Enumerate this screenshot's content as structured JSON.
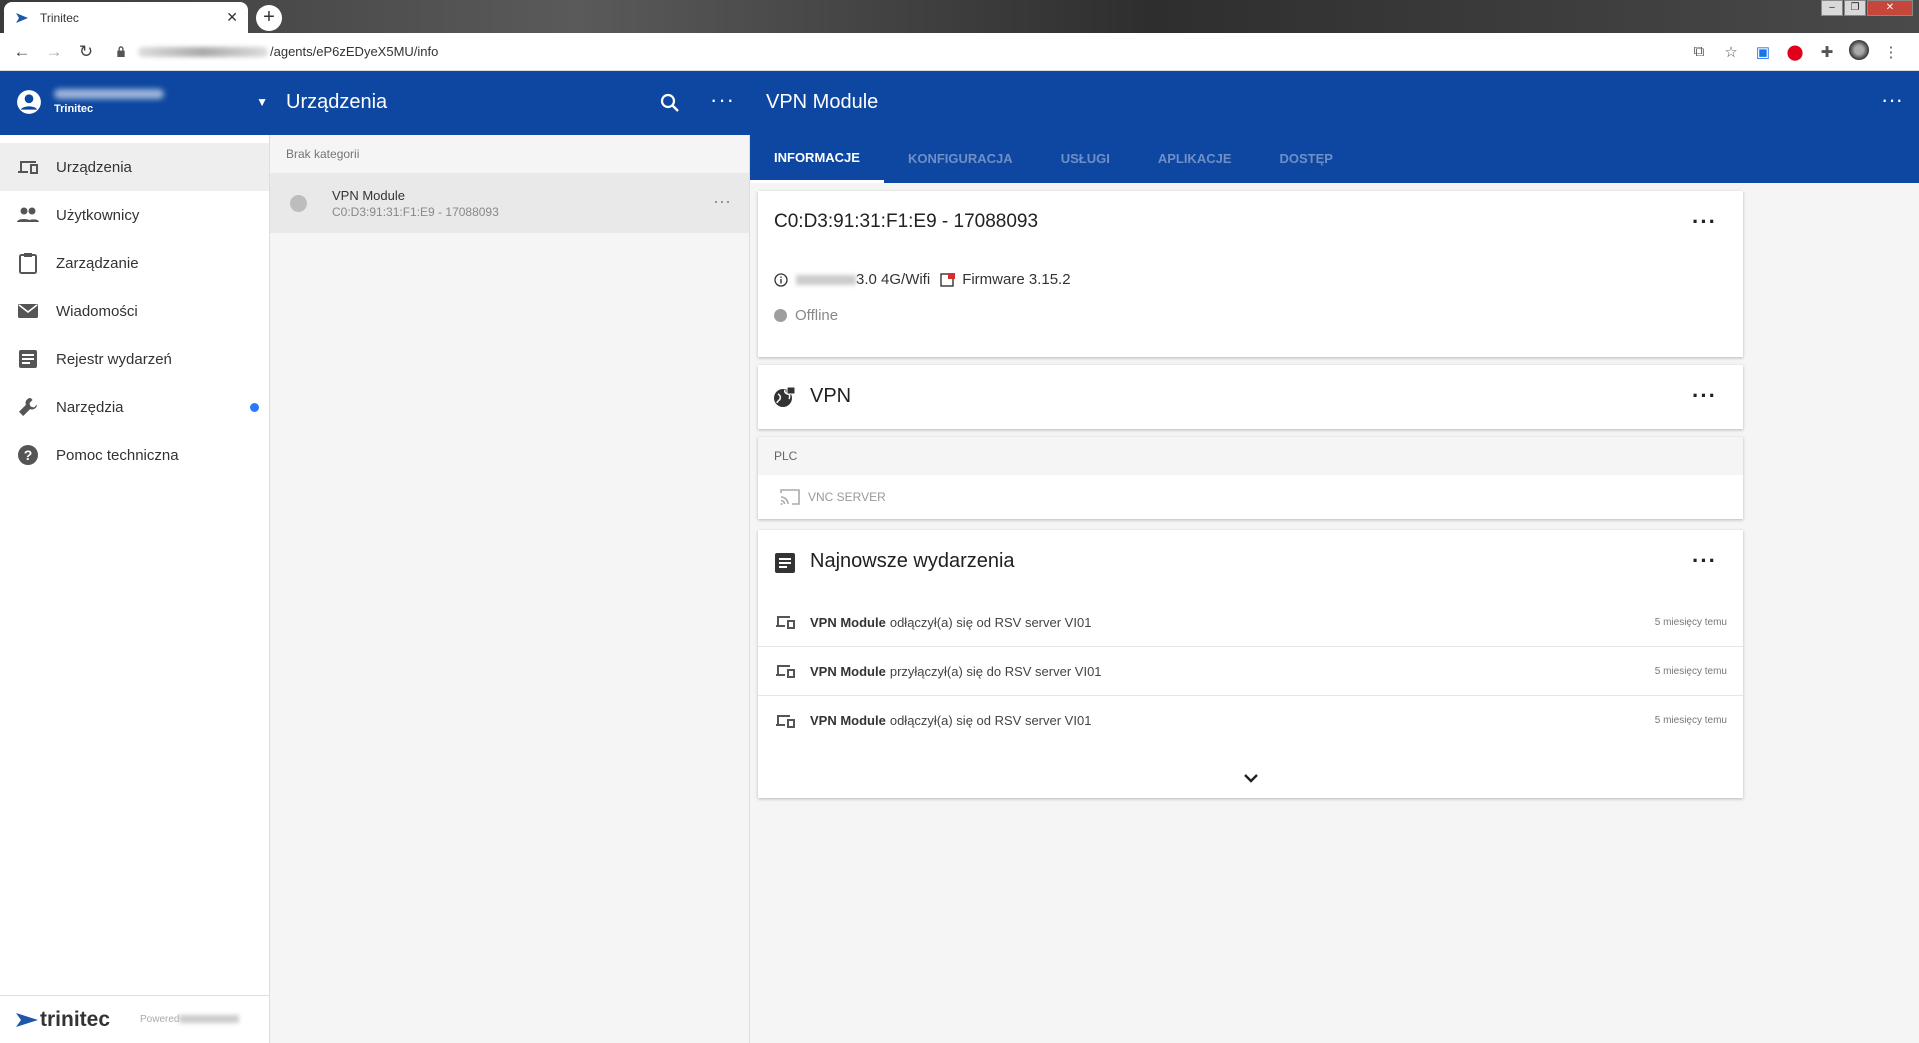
{
  "browser": {
    "tab_title": "Trinitec",
    "url_path": "/agents/eP6zEDyeX5MU/info"
  },
  "account": {
    "org_name": "Trinitec"
  },
  "sidebar": {
    "items": [
      {
        "label": "Urządzenia",
        "icon": "devices-icon"
      },
      {
        "label": "Użytkownicy",
        "icon": "people-icon"
      },
      {
        "label": "Zarządzanie",
        "icon": "clipboard-icon"
      },
      {
        "label": "Wiadomości",
        "icon": "mail-icon"
      },
      {
        "label": "Rejestr wydarzeń",
        "icon": "event-log-icon"
      },
      {
        "label": "Narzędzia",
        "icon": "wrench-icon"
      },
      {
        "label": "Pomoc techniczna",
        "icon": "help-icon"
      }
    ],
    "footer_brand": "trinitec",
    "footer_powered": "Powered"
  },
  "list": {
    "title": "Urządzenia",
    "category": "Brak kategorii",
    "devices": [
      {
        "name": "VPN Module",
        "id": "C0:D3:91:31:F1:E9 - 17088093"
      }
    ]
  },
  "detail": {
    "title": "VPN Module",
    "tabs": [
      "INFORMACJE",
      "KONFIGURACJA",
      "USŁUGI",
      "APLIKACJE",
      "DOSTĘP"
    ],
    "info": {
      "title": "C0:D3:91:31:F1:E9 - 17088093",
      "model": "3.0 4G/Wifi",
      "firmware": "Firmware 3.15.2",
      "status": "Offline"
    },
    "vpn": {
      "title": "VPN",
      "section": "PLC",
      "service": "VNC SERVER"
    },
    "events": {
      "title": "Najnowsze wydarzenia",
      "items": [
        {
          "device": "VPN Module",
          "text": "odłączył(a) się od RSV server VI01",
          "time": "5 miesięcy temu"
        },
        {
          "device": "VPN Module",
          "text": "przyłączył(a) się do RSV server VI01",
          "time": "5 miesięcy temu"
        },
        {
          "device": "VPN Module",
          "text": "odłączył(a) się od RSV server VI01",
          "time": "5 miesięcy temu"
        }
      ]
    }
  },
  "colors": {
    "primary": "#0d47a1",
    "accent_dot": "#2979ff"
  }
}
